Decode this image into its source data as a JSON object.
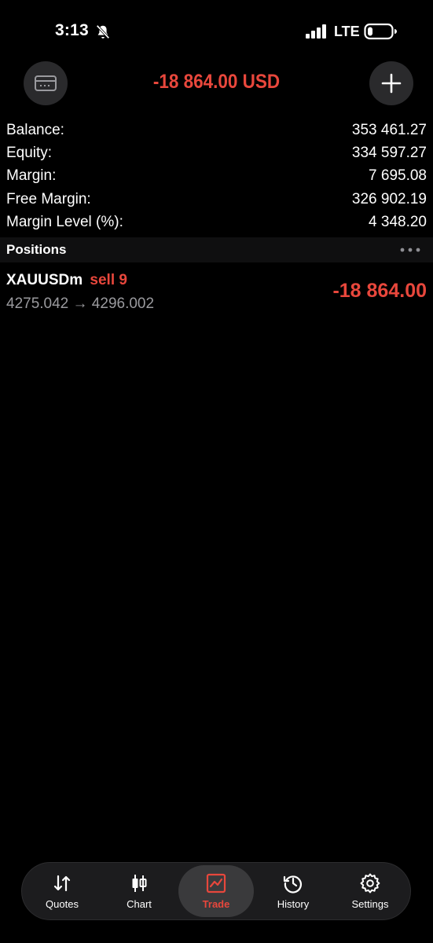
{
  "status_bar": {
    "time": "3:13",
    "network": "LTE"
  },
  "header": {
    "profit": "-18 864.00 USD"
  },
  "summary": [
    {
      "label": "Balance:",
      "value": "353 461.27"
    },
    {
      "label": "Equity:",
      "value": "334 597.27"
    },
    {
      "label": "Margin:",
      "value": "7 695.08"
    },
    {
      "label": "Free Margin:",
      "value": "326 902.19"
    },
    {
      "label": "Margin Level (%):",
      "value": "4 348.20"
    }
  ],
  "positions": {
    "title": "Positions",
    "items": [
      {
        "symbol": "XAUUSDm",
        "side": "sell 9",
        "prices": "4275.042 → 4296.002",
        "profit": "-18 864.00"
      }
    ]
  },
  "tabs": [
    {
      "label": "Quotes",
      "icon": "quotes-icon",
      "active": false
    },
    {
      "label": "Chart",
      "icon": "candlestick-icon",
      "active": false
    },
    {
      "label": "Trade",
      "icon": "trade-icon",
      "active": true
    },
    {
      "label": "History",
      "icon": "history-icon",
      "active": false
    },
    {
      "label": "Settings",
      "icon": "gear-icon",
      "active": false
    }
  ],
  "colors": {
    "loss": "#e8473c",
    "background": "#000000",
    "secondary_text": "#9a9a9e"
  }
}
